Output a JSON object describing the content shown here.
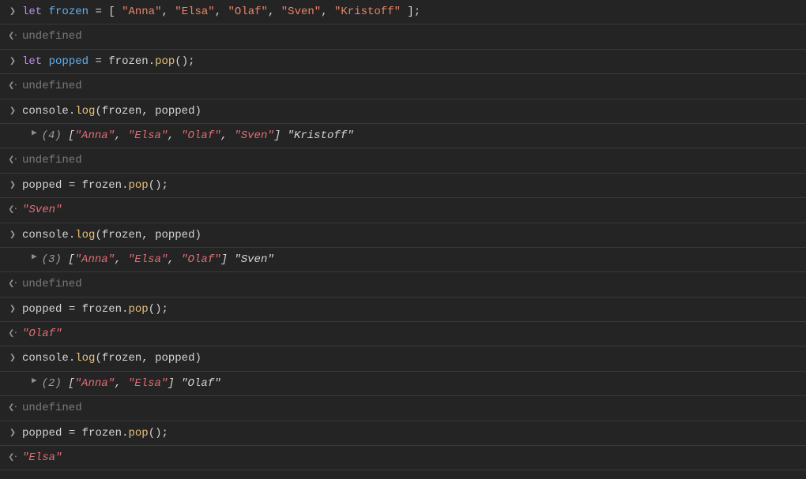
{
  "rows": [
    {
      "type": "input",
      "tokens": [
        {
          "cls": "kw",
          "text": "let"
        },
        {
          "cls": "punct",
          "text": " "
        },
        {
          "cls": "var",
          "text": "frozen"
        },
        {
          "cls": "punct",
          "text": " = [ "
        },
        {
          "cls": "str",
          "text": "\"Anna\""
        },
        {
          "cls": "punct",
          "text": ", "
        },
        {
          "cls": "str",
          "text": "\"Elsa\""
        },
        {
          "cls": "punct",
          "text": ", "
        },
        {
          "cls": "str",
          "text": "\"Olaf\""
        },
        {
          "cls": "punct",
          "text": ", "
        },
        {
          "cls": "str",
          "text": "\"Sven\""
        },
        {
          "cls": "punct",
          "text": ", "
        },
        {
          "cls": "str",
          "text": "\"Kristoff\""
        },
        {
          "cls": "punct",
          "text": " ];"
        }
      ]
    },
    {
      "type": "result-undef",
      "text": "undefined"
    },
    {
      "type": "input",
      "tokens": [
        {
          "cls": "kw",
          "text": "let"
        },
        {
          "cls": "punct",
          "text": " "
        },
        {
          "cls": "var",
          "text": "popped"
        },
        {
          "cls": "punct",
          "text": " = "
        },
        {
          "cls": "obj",
          "text": "frozen"
        },
        {
          "cls": "punct",
          "text": "."
        },
        {
          "cls": "prop",
          "text": "pop"
        },
        {
          "cls": "punct",
          "text": "();"
        }
      ]
    },
    {
      "type": "result-undef",
      "text": "undefined"
    },
    {
      "type": "input",
      "tokens": [
        {
          "cls": "obj",
          "text": "console"
        },
        {
          "cls": "punct",
          "text": "."
        },
        {
          "cls": "prop",
          "text": "log"
        },
        {
          "cls": "punct",
          "text": "("
        },
        {
          "cls": "obj",
          "text": "frozen"
        },
        {
          "cls": "punct",
          "text": ", "
        },
        {
          "cls": "obj",
          "text": "popped"
        },
        {
          "cls": "punct",
          "text": ")"
        }
      ]
    },
    {
      "type": "log",
      "count": "(4)",
      "items": [
        "\"Anna\"",
        "\"Elsa\"",
        "\"Olaf\"",
        "\"Sven\""
      ],
      "tail": "\"Kristoff\""
    },
    {
      "type": "result-undef",
      "text": "undefined"
    },
    {
      "type": "input",
      "tokens": [
        {
          "cls": "obj",
          "text": "popped"
        },
        {
          "cls": "punct",
          "text": " = "
        },
        {
          "cls": "obj",
          "text": "frozen"
        },
        {
          "cls": "punct",
          "text": "."
        },
        {
          "cls": "prop",
          "text": "pop"
        },
        {
          "cls": "punct",
          "text": "();"
        }
      ]
    },
    {
      "type": "result-string",
      "text": "\"Sven\""
    },
    {
      "type": "input",
      "tokens": [
        {
          "cls": "obj",
          "text": "console"
        },
        {
          "cls": "punct",
          "text": "."
        },
        {
          "cls": "prop",
          "text": "log"
        },
        {
          "cls": "punct",
          "text": "("
        },
        {
          "cls": "obj",
          "text": "frozen"
        },
        {
          "cls": "punct",
          "text": ", "
        },
        {
          "cls": "obj",
          "text": "popped"
        },
        {
          "cls": "punct",
          "text": ")"
        }
      ]
    },
    {
      "type": "log",
      "count": "(3)",
      "items": [
        "\"Anna\"",
        "\"Elsa\"",
        "\"Olaf\""
      ],
      "tail": "\"Sven\""
    },
    {
      "type": "result-undef",
      "text": "undefined"
    },
    {
      "type": "input",
      "tokens": [
        {
          "cls": "obj",
          "text": "popped"
        },
        {
          "cls": "punct",
          "text": " = "
        },
        {
          "cls": "obj",
          "text": "frozen"
        },
        {
          "cls": "punct",
          "text": "."
        },
        {
          "cls": "prop",
          "text": "pop"
        },
        {
          "cls": "punct",
          "text": "();"
        }
      ]
    },
    {
      "type": "result-string",
      "text": "\"Olaf\""
    },
    {
      "type": "input",
      "tokens": [
        {
          "cls": "obj",
          "text": "console"
        },
        {
          "cls": "punct",
          "text": "."
        },
        {
          "cls": "prop",
          "text": "log"
        },
        {
          "cls": "punct",
          "text": "("
        },
        {
          "cls": "obj",
          "text": "frozen"
        },
        {
          "cls": "punct",
          "text": ", "
        },
        {
          "cls": "obj",
          "text": "popped"
        },
        {
          "cls": "punct",
          "text": ")"
        }
      ]
    },
    {
      "type": "log",
      "count": "(2)",
      "items": [
        "\"Anna\"",
        "\"Elsa\""
      ],
      "tail": "\"Olaf\""
    },
    {
      "type": "result-undef",
      "text": "undefined"
    },
    {
      "type": "input",
      "tokens": [
        {
          "cls": "obj",
          "text": "popped"
        },
        {
          "cls": "punct",
          "text": " = "
        },
        {
          "cls": "obj",
          "text": "frozen"
        },
        {
          "cls": "punct",
          "text": "."
        },
        {
          "cls": "prop",
          "text": "pop"
        },
        {
          "cls": "punct",
          "text": "();"
        }
      ]
    },
    {
      "type": "result-string",
      "text": "\"Elsa\""
    }
  ],
  "glyphs": {
    "input_chevron": "❯",
    "output_chevron": "❮⸱",
    "output_chevron_plain": "❮",
    "expand_triangle": "▶"
  }
}
